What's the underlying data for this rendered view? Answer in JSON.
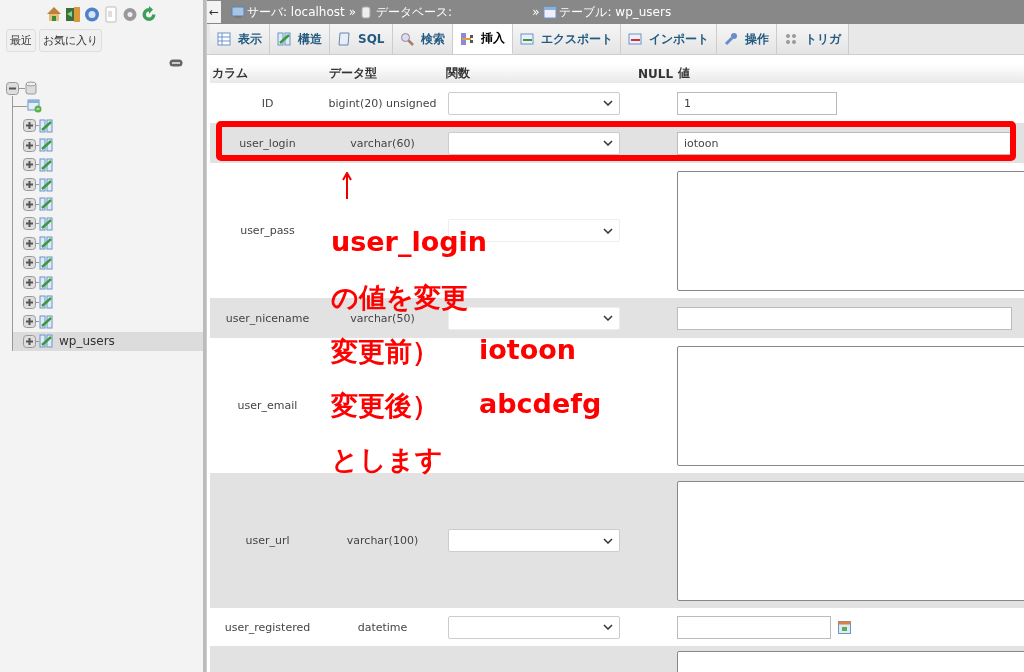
{
  "sidebar": {
    "buttons": [
      {
        "label": "最近"
      },
      {
        "label": "お気に入り"
      }
    ],
    "tree": {
      "expanded": true,
      "children": [
        {
          "kind": "new"
        },
        {
          "kind": "table",
          "selected": false
        },
        {
          "kind": "table",
          "selected": false
        },
        {
          "kind": "table",
          "selected": false
        },
        {
          "kind": "table",
          "selected": false
        },
        {
          "kind": "table",
          "selected": false
        },
        {
          "kind": "table",
          "selected": false
        },
        {
          "kind": "table",
          "selected": false
        },
        {
          "kind": "table",
          "selected": false
        },
        {
          "kind": "table",
          "selected": false
        },
        {
          "kind": "table",
          "selected": false
        },
        {
          "kind": "table",
          "selected": false
        },
        {
          "kind": "table",
          "label": "wp_users",
          "selected": true
        }
      ]
    }
  },
  "breadcrumb": {
    "back": "←",
    "separator": "»",
    "crumbs": [
      {
        "kind": "server",
        "label": "サーバ: localhost"
      },
      {
        "kind": "database",
        "label": "データベース:"
      },
      {
        "kind": "table",
        "label": "テーブル: wp_users"
      }
    ]
  },
  "tabs": [
    {
      "kind": "browse",
      "label": "表示",
      "selected": false
    },
    {
      "kind": "structure",
      "label": "構造",
      "selected": false
    },
    {
      "kind": "sql",
      "label": "SQL",
      "selected": false
    },
    {
      "kind": "search",
      "label": "検索",
      "selected": false
    },
    {
      "kind": "insert",
      "label": "挿入",
      "selected": true
    },
    {
      "kind": "export",
      "label": "エクスポート",
      "selected": false
    },
    {
      "kind": "import",
      "label": "インポート",
      "selected": false
    },
    {
      "kind": "operations",
      "label": "操作",
      "selected": false
    },
    {
      "kind": "triggers",
      "label": "トリガ",
      "selected": false
    }
  ],
  "table": {
    "columns": [
      "カラム",
      "データ型",
      "関数",
      "NULL",
      "値"
    ],
    "rows": [
      {
        "column": "ID",
        "type": "bigint(20) unsigned",
        "kind": "text",
        "function_field": true,
        "value": "1",
        "highlighted": false
      },
      {
        "column": "user_login",
        "type": "varchar(60)",
        "kind": "wide",
        "function_field": true,
        "value": "iotoon",
        "highlighted": true
      },
      {
        "column": "user_pass",
        "kind": "textarea",
        "function_field": true,
        "highlighted": false
      },
      {
        "column": "user_nicename",
        "type": "varchar(50)",
        "kind": "wide",
        "function_field": true,
        "highlighted": false
      },
      {
        "column": "user_email",
        "kind": "textarea",
        "function_field": false,
        "highlighted": false
      },
      {
        "column": "user_url",
        "type": "varchar(100)",
        "kind": "textarea",
        "function_field": true,
        "highlighted": false
      },
      {
        "column": "user_registered",
        "type": "datetime",
        "kind": "date",
        "function_field": true,
        "highlighted": false
      },
      {
        "kind": "textarea",
        "function_field": false,
        "highlighted": false
      }
    ]
  },
  "annotation": {
    "lines": [
      {
        "text": "user_login"
      },
      {
        "text": "の値を変更"
      },
      {
        "text": "変更前）",
        "value": "iotoon"
      },
      {
        "text": "変更後）",
        "value": "abcdefg"
      },
      {
        "text": "とします"
      }
    ]
  }
}
